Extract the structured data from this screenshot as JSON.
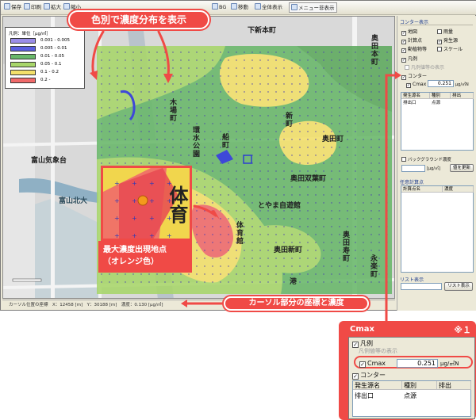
{
  "toolbar": {
    "items": [
      "保存",
      "印刷",
      "拡大",
      "縮小",
      "移動",
      "全体表示",
      "全期間",
      "1H",
      "メニュー非表示"
    ],
    "partial_left": "ベンゼン",
    "partial_left2": "長期",
    "partial_left3": "全期・全時間帯表示",
    "partial_mid": "BG"
  },
  "callout_top": "色別で濃度分布を表示",
  "legend": {
    "title": "凡例：単位［μg/㎥］",
    "rows": [
      {
        "color": "#9b8ee8",
        "label": "0.001 - 0.005"
      },
      {
        "color": "#5b5fe0",
        "label": "0.005 - 0.01"
      },
      {
        "color": "#69b86a",
        "label": "0.01 - 0.05"
      },
      {
        "color": "#a8d66a",
        "label": "0.05 - 0.1"
      },
      {
        "color": "#f3e06a",
        "label": "0.1 - 0.2"
      },
      {
        "color": "#f06a6a",
        "label": "0.2 -"
      }
    ]
  },
  "map_labels": {
    "shimoshinhon": "下新本町",
    "okuda_honmachi": "奥田本町",
    "kibacho": "木場町",
    "kannonbashi": "環水公園",
    "shinjo": "新町",
    "okudamachi": "奥田町",
    "okuda_futaba": "奥田双葉町",
    "toyama_jidokan": "とやま自遊館",
    "okuda_shinmachi": "奥田新町",
    "okuda_juucho": "奥田寿町",
    "meteo": "富山気象台",
    "hokudai": "富山北大",
    "taiiku": "体育館",
    "ushijima": "牛島",
    "eitai": "永楽町",
    "minato": "港",
    "kurubamachi": "船町"
  },
  "inset_text": "体育",
  "inset_caption": [
    "最大濃度出現地点",
    "（オレンジ色）"
  ],
  "status": {
    "text": "カーソル位置の座標　X：12458 [m]　Y：30188 [m]　濃度：0.130 [μg/㎥]",
    "callout": "カーソル部分の座標と濃度"
  },
  "panel": {
    "section_contour": "コンター表示",
    "check_items": [
      {
        "label": "地図",
        "checked": true
      },
      {
        "label": "雨量",
        "checked": false
      },
      {
        "label": "計算点",
        "checked": true
      },
      {
        "label": "発生源",
        "checked": true
      },
      {
        "label": "動植物等",
        "checked": true
      },
      {
        "label": "スケール",
        "checked": false
      },
      {
        "label": "凡例",
        "checked": true
      },
      {
        "label": "コンター",
        "checked": true
      }
    ],
    "disabled_item": "凡例値等の表示",
    "cmax_label": "Cmax",
    "cmax_value": "0.251",
    "cmax_unit": "μg/㎥N",
    "source_table": {
      "headers": [
        "発生源名",
        "種別",
        "排出"
      ],
      "rows": [
        [
          "排出口",
          "点源",
          ""
        ]
      ]
    },
    "bg_label": "バックグラウンド濃度",
    "bg_unit": "[μg/㎥]",
    "bg_button": "値を更新",
    "arbitrary_title": "任意計算点",
    "arb_headers": [
      "計算点名",
      "濃度"
    ],
    "list_label": "リスト表示",
    "list_button": "リスト表示"
  },
  "zoom": {
    "marker": "※１",
    "cmax_label": "Cmax",
    "legend_item": "凡例",
    "disabled_item": "凡例値等の表示",
    "contour": "コンター",
    "cmax_value": "0.251",
    "cmax_unit": "μg/㎥N",
    "headers": [
      "発生源名",
      "種別",
      "排出"
    ],
    "row": [
      "排出口",
      "点源",
      ""
    ]
  }
}
